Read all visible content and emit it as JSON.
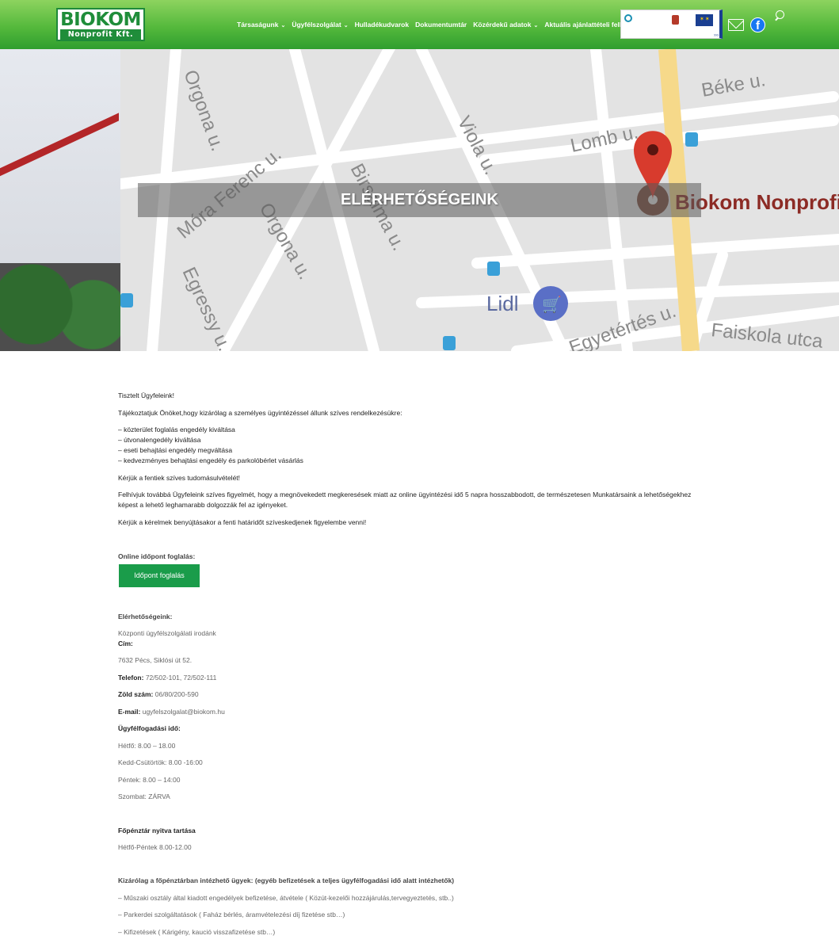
{
  "header": {
    "logo_top": "BIOKOM",
    "logo_bottom": "Nonprofit Kft.",
    "nav": [
      {
        "label": "Társaságunk",
        "dropdown": true
      },
      {
        "label": "Ügyfélszolgálat",
        "dropdown": true
      },
      {
        "label": "Hulladékudvarok",
        "dropdown": false
      },
      {
        "label": "Dokumentumtár",
        "dropdown": false
      },
      {
        "label": "Közérdekű adatok",
        "dropdown": true
      },
      {
        "label": "Aktuális ajánlattételi felhívás",
        "dropdown": false
      }
    ],
    "icons": {
      "mail": "mail-icon",
      "facebook": "facebook-icon",
      "search": "search-icon"
    }
  },
  "hero": {
    "title": "ELÉRHETŐSÉGEINK",
    "map_labels": {
      "street_1": "Orgona u.",
      "street_2": "Móra Ferenc u.",
      "street_3": "Orgona u.",
      "street_4": "Egressy u.",
      "street_5": "Viola u.",
      "street_6": "Lomb u.",
      "street_7": "Béke u.",
      "street_8": "Birsalma u.",
      "street_9": "Egyetértés u.",
      "street_10": "Faiskola utca",
      "poi_1": "Biokom Nonprofit",
      "poi_2": "Lidl"
    }
  },
  "content": {
    "greeting": "Tisztelt Ügyfeleink!",
    "intro": "Tájékoztatjuk Önöket,hogy kizárólag a személyes ügyintézéssel állunk szíves rendelkezésükre:",
    "services": [
      "– közterület foglalás engedély kiváltása",
      "– útvonalengedély kiváltása",
      "– eseti behajtási engedély megváltása",
      "– kedvezményes behajtási engedély és parkolóbérlet vásárlás"
    ],
    "ack": "Kérjük a fentiek szíves tudomásulvételét!",
    "notice_line1": "Felhívjuk továbbá Ügyfeleink szíves figyelmét, hogy a megnövekedett megkeresések miatt az online ügyintézési idő 5 napra hosszabbodott, de természetesen Munkatársaink a lehetőségekhez",
    "notice_line2": "képest a lehető leghamarabb dolgozzák fel az igényeket.",
    "deadline": "Kérjük a kérelmek benyújtásakor a fenti határidőt szíveskedjenek figyelembe venni!",
    "online_label": "Online időpont foglalás:",
    "booking_button": "Időpont foglalás",
    "contacts_heading": "Elérhetőségeink:",
    "office": "Központi ügyfélszolgálati irodánk",
    "address_label": "Cím:",
    "address": "7632 Pécs, Siklósi út 52.",
    "phone_label": "Telefon:",
    "phone": "72/502-101, 72/502-111",
    "green_label": "Zöld szám:",
    "green": "06/80/200-590",
    "email_label": "E-mail:",
    "email": "ugyfelszolgalat@biokom.hu",
    "hours_heading": "Ügyfélfogadási idő:",
    "hours": [
      "Hétfő: 8.00 – 18.00",
      "Kedd-Csütörtök: 8.00 -16:00",
      "Péntek: 8.00 – 14:00",
      "Szombat: ZÁRVA"
    ],
    "cashier_heading": "Főpénztár nyitva tartása",
    "cashier_hours": "Hétfő-Péntek 8.00-12.00",
    "cashier_only_heading": "Kizárólag a főpénztárban intézhető ügyek: (egyéb befizetések a teljes ügyfélfogadási idő alatt intézhetők)",
    "cashier_items": [
      "– Műszaki osztály által kiadott engedélyek befizetése, átvétele ( Közút-kezelői hozzájárulás,tervegyeztetés, stb..)",
      "– Parkerdei szolgáltatások ( Faház bérlés, áramvételezési díj fizetése stb…)",
      "–  Kifizetések ( Kárigény, kaució visszafizetése stb…)"
    ]
  }
}
